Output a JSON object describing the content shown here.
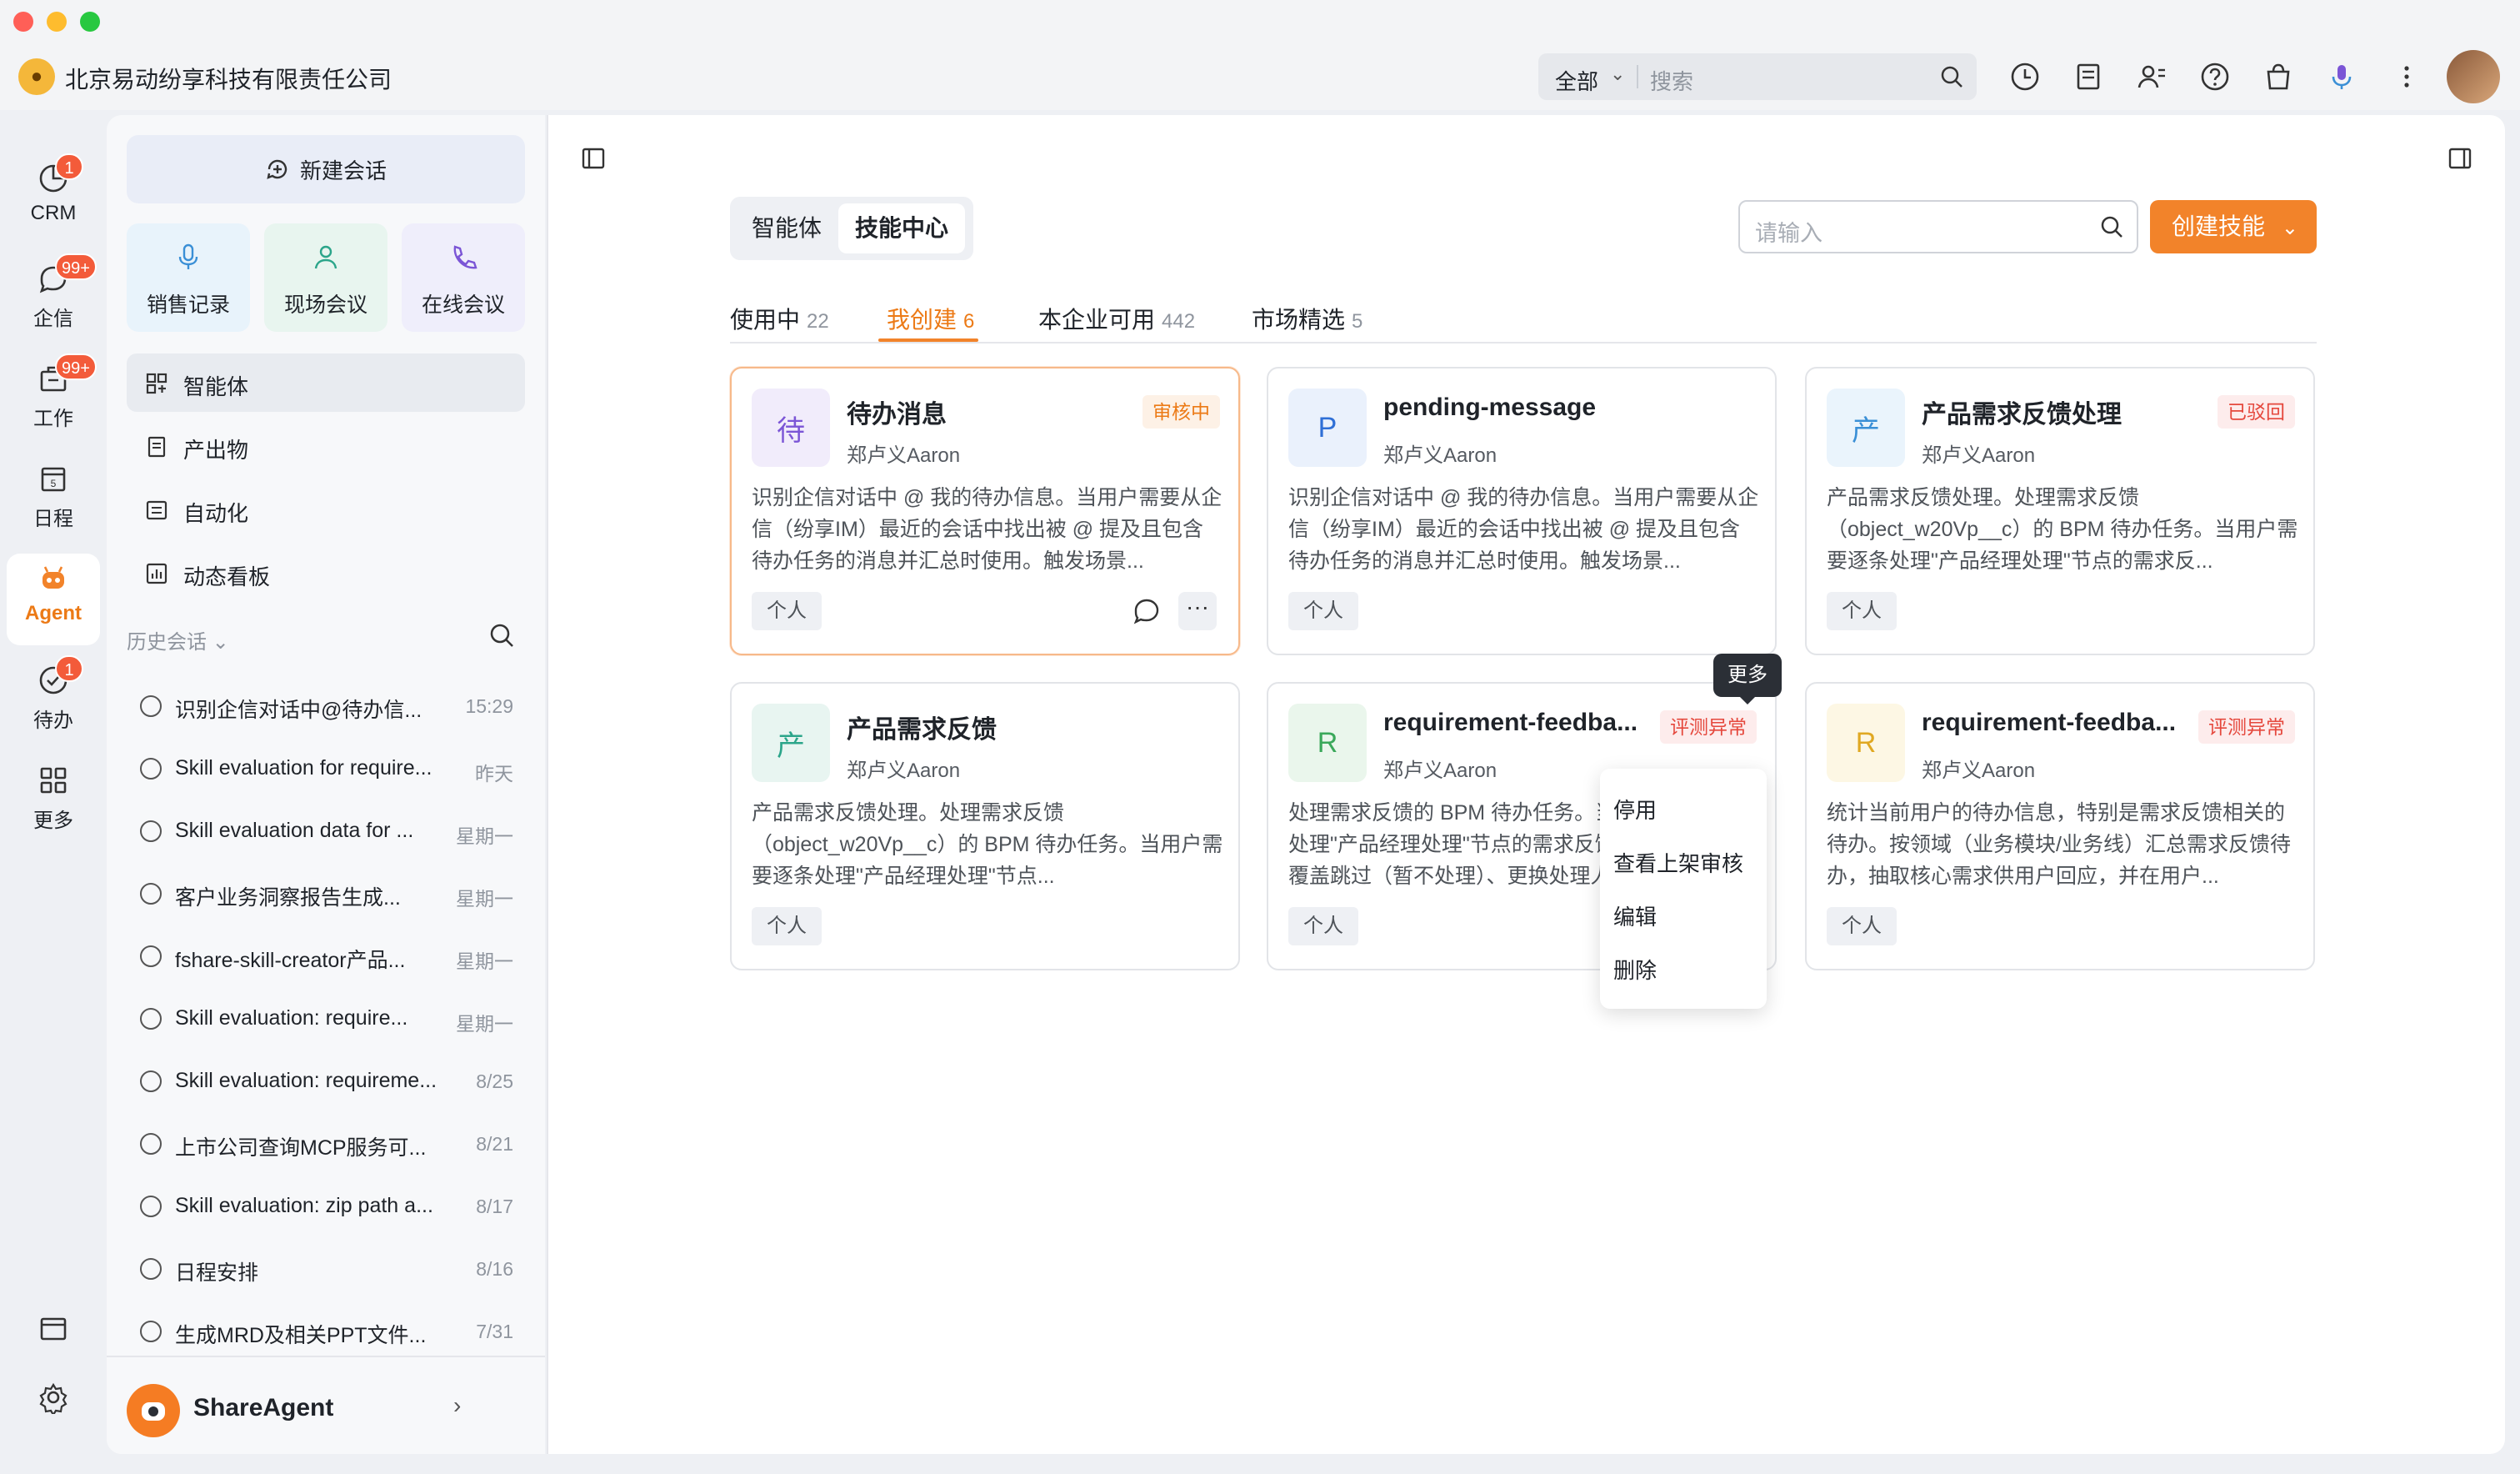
{
  "topbar": {
    "company_name": "北京易动纷享科技有限责任公司",
    "search_scope": "全部",
    "search_placeholder": "搜索"
  },
  "rail": {
    "items": [
      {
        "label": "CRM",
        "badge": "1"
      },
      {
        "label": "企信",
        "badge": "99+"
      },
      {
        "label": "工作",
        "badge": "99+"
      },
      {
        "label": "日程",
        "badge": ""
      },
      {
        "label": "Agent",
        "badge": ""
      },
      {
        "label": "待办",
        "badge": "1"
      },
      {
        "label": "更多",
        "badge": ""
      }
    ]
  },
  "sidebar": {
    "new_chat": "新建会话",
    "quick": [
      {
        "label": "销售记录",
        "color": "#e8f3fb"
      },
      {
        "label": "现场会议",
        "color": "#e8f5ef"
      },
      {
        "label": "在线会议",
        "color": "#efeefb"
      }
    ],
    "menu": [
      {
        "label": "智能体"
      },
      {
        "label": "产出物"
      },
      {
        "label": "自动化"
      },
      {
        "label": "动态看板"
      }
    ],
    "history_title": "历史会话",
    "history": [
      {
        "text": "识别企信对话中@待办信...",
        "time": "15:29"
      },
      {
        "text": "Skill evaluation for require...",
        "time": "昨天"
      },
      {
        "text": "Skill evaluation data for ...",
        "time": "星期一"
      },
      {
        "text": "客户业务洞察报告生成...",
        "time": "星期一"
      },
      {
        "text": "fshare-skill-creator产品...",
        "time": "星期一"
      },
      {
        "text": "Skill evaluation: require...",
        "time": "星期一"
      },
      {
        "text": "Skill evaluation: requireme...",
        "time": "8/25"
      },
      {
        "text": "上市公司查询MCP服务可...",
        "time": "8/21"
      },
      {
        "text": "Skill evaluation: zip path a...",
        "time": "8/17"
      },
      {
        "text": "日程安排",
        "time": "8/16"
      },
      {
        "text": "生成MRD及相关PPT文件...",
        "time": "7/31"
      }
    ],
    "footer_name": "ShareAgent"
  },
  "main": {
    "segment": {
      "a": "智能体",
      "b": "技能中心"
    },
    "search_placeholder": "请输入",
    "create_label": "创建技能",
    "tabs": [
      {
        "label": "使用中",
        "count": "22"
      },
      {
        "label": "我创建",
        "count": "6"
      },
      {
        "label": "本企业可用",
        "count": "442"
      },
      {
        "label": "市场精选",
        "count": "5"
      }
    ],
    "cards": [
      {
        "avatar": "待",
        "avatar_bg": "#f1ecfb",
        "avatar_fg": "#7b55d6",
        "title": "待办消息",
        "author": "郑卢义Aaron",
        "status": "审核中",
        "desc": "识别企信对话中 @ 我的待办信息。当用户需要从企信（纷享IM）最近的会话中找出被 @ 提及且包含待办任务的消息并汇总时使用。触发场景...",
        "tag": "个人"
      },
      {
        "avatar": "P",
        "avatar_bg": "#eaf1fc",
        "avatar_fg": "#2f6fd6",
        "title": "pending-message",
        "author": "郑卢义Aaron",
        "status": "",
        "desc": "识别企信对话中 @ 我的待办信息。当用户需要从企信（纷享IM）最近的会话中找出被 @ 提及且包含待办任务的消息并汇总时使用。触发场景...",
        "tag": "个人"
      },
      {
        "avatar": "产",
        "avatar_bg": "#eaf4fc",
        "avatar_fg": "#3a8fd6",
        "title": "产品需求反馈处理",
        "author": "郑卢义Aaron",
        "status": "已驳回",
        "desc": "产品需求反馈处理。处理需求反馈（object_w20Vp__c）的 BPM 待办任务。当用户需要逐条处理\"产品经理处理\"节点的需求反...",
        "tag": "个人"
      },
      {
        "avatar": "产",
        "avatar_bg": "#e8f5f1",
        "avatar_fg": "#2ba58a",
        "title": "产品需求反馈",
        "author": "郑卢义Aaron",
        "status": "",
        "desc": "产品需求反馈处理。处理需求反馈（object_w20Vp__c）的 BPM 待办任务。当用户需要逐条处理\"产品经理处理\"节点...",
        "tag": "个人"
      },
      {
        "avatar": "R",
        "avatar_bg": "#eaf6ec",
        "avatar_fg": "#3aa85a",
        "title": "requirement-feedba...",
        "author": "郑卢义Aaron",
        "status": "评测异常",
        "desc": "处理需求反馈的 BPM 待办任务。当用户需要逐条处理\"产品经理处理\"节点的需求反馈待办时使用，覆盖跳过（暂不处理）、更换处理人、完...",
        "tag": "个人"
      },
      {
        "avatar": "R",
        "avatar_bg": "#fdf7e4",
        "avatar_fg": "#e0a822",
        "title": "requirement-feedba...",
        "author": "郑卢义Aaron",
        "status": "评测异常",
        "desc": "统计当前用户的待办信息，特别是需求反馈相关的待办。按领域（业务模块/业务线）汇总需求反馈待办，抽取核心需求供用户回应，并在用户...",
        "tag": "个人"
      }
    ],
    "tooltip": "更多",
    "dropdown": [
      "停用",
      "查看上架审核",
      "编辑",
      "删除"
    ]
  }
}
